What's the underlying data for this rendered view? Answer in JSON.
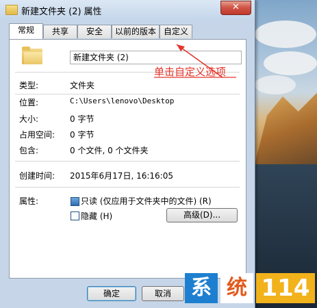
{
  "window": {
    "title": "新建文件夹 (2) 属性",
    "close_label": "✕"
  },
  "tabs": [
    {
      "label": "常规",
      "active": true
    },
    {
      "label": "共享",
      "active": false
    },
    {
      "label": "安全",
      "active": false
    },
    {
      "label": "以前的版本",
      "active": false
    },
    {
      "label": "自定义",
      "active": false
    }
  ],
  "general": {
    "folder_name": "新建文件夹 (2)",
    "type_label": "类型:",
    "type_value": "文件夹",
    "location_label": "位置:",
    "location_value": "C:\\Users\\lenovo\\Desktop",
    "size_label": "大小:",
    "size_value": "0 字节",
    "size_on_disk_label": "占用空间:",
    "size_on_disk_value": "0 字节",
    "contains_label": "包含:",
    "contains_value": "0 个文件, 0 个文件夹",
    "created_label": "创建时间:",
    "created_value": "2015年6月17日, 16:16:05",
    "attributes_label": "属性:",
    "readonly_label": "只读 (仅应用于文件夹中的文件) (R)",
    "readonly_checked": true,
    "hidden_label": "隐藏 (H)",
    "hidden_checked": false,
    "advanced_button": "高级(D)..."
  },
  "footer": {
    "ok_label": "确定",
    "cancel_label": "取消"
  },
  "annotation": "单击自定义选项",
  "watermark": {
    "chars": [
      "系",
      "统",
      "114"
    ],
    "colors": [
      "#1e7fd0",
      "#e25a1c",
      "#f2b21b"
    ]
  }
}
